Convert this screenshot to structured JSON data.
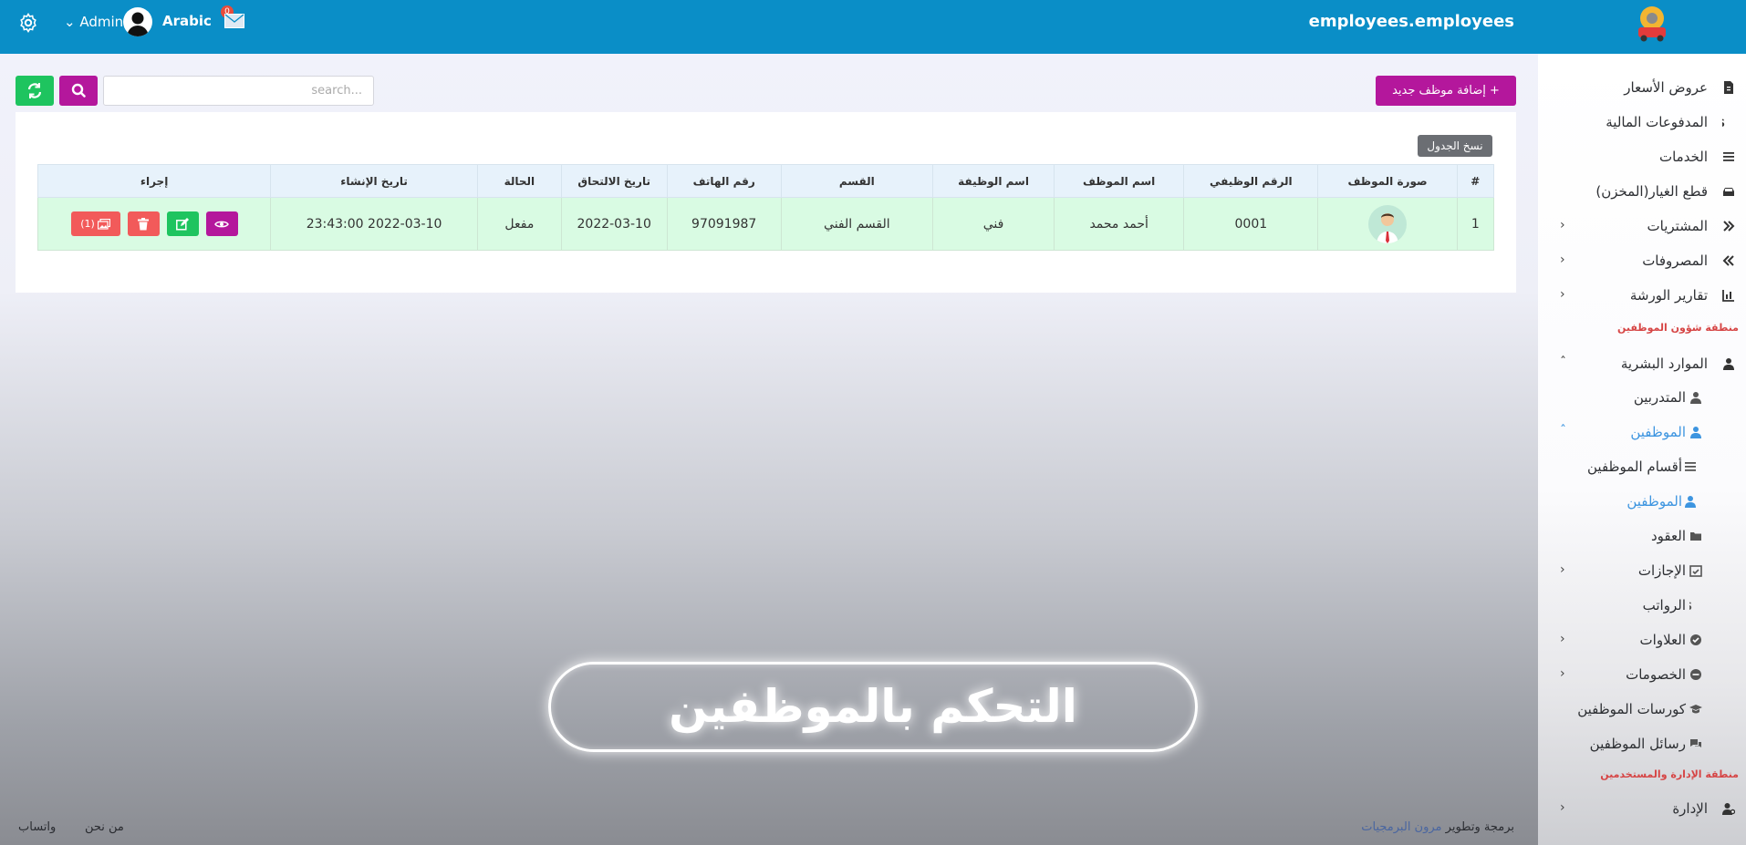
{
  "header": {
    "brand": "employees.employees",
    "admin_label": "Admin",
    "language_label": "Arabic",
    "mail_count": "0"
  },
  "toolbar": {
    "search_placeholder": "search...",
    "add_button": "+ إضافة موظف جديد",
    "copy_table": "نسخ الجدول"
  },
  "table": {
    "columns": [
      "#",
      "صورة الموظف",
      "الرقم الوظيفي",
      "اسم الموظف",
      "اسم الوظيفة",
      "القسم",
      "رقم الهاتف",
      "تاريخ الالتحاق",
      "الحالة",
      "تاريخ الإنشاء",
      "إجراء"
    ],
    "rows": [
      {
        "index": "1",
        "employee_no": "0001",
        "name": "أحمد محمد",
        "job": "فني",
        "department": "القسم الفني",
        "phone": "97091987",
        "join_date": "2022-03-10",
        "status": "مفعل",
        "created_at": "2022-03-10 23:43:00",
        "images_count": "(1)"
      }
    ]
  },
  "banner": {
    "text": "التحكم بالموظفين"
  },
  "footer": {
    "about": "من نحن",
    "whatsapp": "واتساب",
    "credit_prefix": "برمجة وتطوير",
    "credit_brand": "مرون البرمجيات"
  },
  "sidebar": {
    "items": [
      {
        "label": "عروض الأسعار",
        "icon": "file-invoice-icon"
      },
      {
        "label": "المدفوعات المالية",
        "icon": "dollar-icon"
      },
      {
        "label": "الخدمات",
        "icon": "list-icon"
      },
      {
        "label": "قطع الغيار(المخزن)",
        "icon": "car-icon"
      },
      {
        "label": "المشتريات",
        "icon": "double-chevron-right-icon"
      },
      {
        "label": "المصروفات",
        "icon": "double-chevron-left-icon"
      },
      {
        "label": "تقارير الورشة",
        "icon": "chart-icon"
      },
      {
        "label": "الموارد البشرية",
        "icon": "user-icon"
      },
      {
        "label": "المتدربين",
        "icon": "user-icon"
      },
      {
        "label": "الموظفين",
        "icon": "user-icon"
      },
      {
        "label": "أقسام الموظفين",
        "icon": "list-icon"
      },
      {
        "label": "الموظفين",
        "icon": "user-icon"
      },
      {
        "label": "العقود",
        "icon": "folder-icon"
      },
      {
        "label": "الإجازات",
        "icon": "calendar-check-icon"
      },
      {
        "label": "الرواتب",
        "icon": "dollar-icon"
      },
      {
        "label": "العلاوات",
        "icon": "check-circle-icon"
      },
      {
        "label": "الخصومات",
        "icon": "minus-circle-icon"
      },
      {
        "label": "كورسات الموظفين",
        "icon": "graduation-cap-icon"
      },
      {
        "label": "رسائل الموظفين",
        "icon": "comments-icon"
      },
      {
        "label": "الإدارة",
        "icon": "user-cog-icon"
      }
    ],
    "section_employees": "منطقة شؤون الموظفين",
    "section_admin": "منطقة الإدارة والمستخدمين"
  },
  "colors": {
    "topbar": "#0a8ec7",
    "accent_purple": "#b4179c",
    "accent_green": "#1ec45f",
    "danger": "#f25a5a",
    "row_bg": "#d9fbe3",
    "active_link": "#3d95e0",
    "section_red": "#d64545"
  }
}
